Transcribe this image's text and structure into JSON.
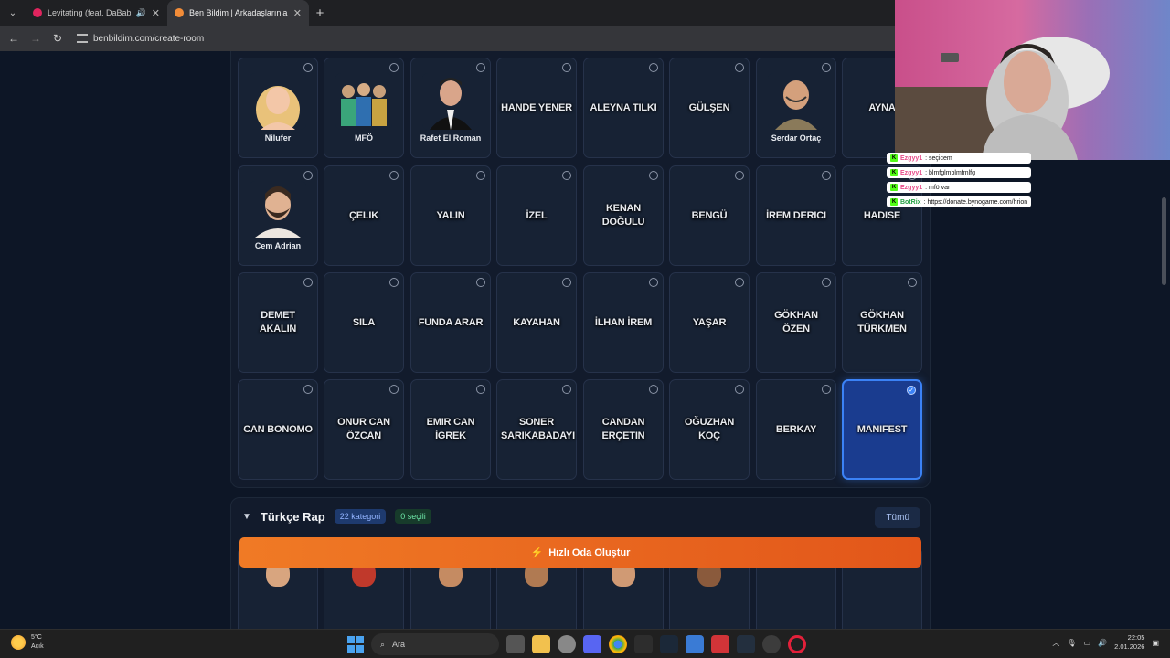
{
  "browser": {
    "tabs": [
      {
        "title": "Levitating (feat. DaBaby) - Y",
        "active": false,
        "favicon_color": "#e0245e"
      },
      {
        "title": "Ben Bildim | Arkadaşlarınla Onl",
        "active": true,
        "favicon_color": "#f28c38"
      }
    ],
    "url": "benbildim.com/create-room"
  },
  "grid": {
    "cards": [
      {
        "label": "Nilufer",
        "type": "image",
        "avatar": "woman-blonde"
      },
      {
        "label": "MFÖ",
        "type": "image",
        "avatar": "trio"
      },
      {
        "label": "Rafet El Roman",
        "type": "image",
        "avatar": "man-tuxedo"
      },
      {
        "label": "HANDE YENER",
        "type": "text"
      },
      {
        "label": "ALEYNA TILKI",
        "type": "text"
      },
      {
        "label": "GÜLŞEN",
        "type": "text"
      },
      {
        "label": "Serdar Ortaç",
        "type": "image",
        "avatar": "man-bald"
      },
      {
        "label": "AYNA",
        "type": "text"
      },
      {
        "label": "Cem Adrian",
        "type": "image",
        "avatar": "man-beard"
      },
      {
        "label": "ÇELIK",
        "type": "text"
      },
      {
        "label": "YALIN",
        "type": "text"
      },
      {
        "label": "İZEL",
        "type": "text"
      },
      {
        "label": "KENAN DOĞULU",
        "type": "text"
      },
      {
        "label": "BENGÜ",
        "type": "text"
      },
      {
        "label": "İREM DERICI",
        "type": "text"
      },
      {
        "label": "HADISE",
        "type": "text"
      },
      {
        "label": "DEMET AKALIN",
        "type": "text"
      },
      {
        "label": "SILA",
        "type": "text"
      },
      {
        "label": "FUNDA ARAR",
        "type": "text"
      },
      {
        "label": "KAYAHAN",
        "type": "text"
      },
      {
        "label": "İLHAN İREM",
        "type": "text"
      },
      {
        "label": "YAŞAR",
        "type": "text"
      },
      {
        "label": "GÖKHAN ÖZEN",
        "type": "text"
      },
      {
        "label": "GÖKHAN TÜRKMEN",
        "type": "text"
      },
      {
        "label": "CAN BONOMO",
        "type": "text"
      },
      {
        "label": "ONUR CAN ÖZCAN",
        "type": "text"
      },
      {
        "label": "EMIR CAN İGREK",
        "type": "text"
      },
      {
        "label": "SONER SARIKABADAYI",
        "type": "text"
      },
      {
        "label": "CANDAN ERÇETIN",
        "type": "text"
      },
      {
        "label": "OĞUZHAN KOÇ",
        "type": "text"
      },
      {
        "label": "BERKAY",
        "type": "text"
      },
      {
        "label": "MANIFEST",
        "type": "text",
        "selected": true
      }
    ]
  },
  "section": {
    "title": "Türkçe Rap",
    "categories_badge": "22 kategori",
    "selected_badge": "0 seçili",
    "all_button": "Tümü"
  },
  "create_button": "Hızlı Oda Oluştur",
  "chat": [
    {
      "user": "Ezgyy1",
      "message": ": seçicem",
      "user_color": "pink"
    },
    {
      "user": "Ezgyy1",
      "message": ": blmfglmblmfmlfg",
      "user_color": "pink"
    },
    {
      "user": "Ezgyy1",
      "message": ": mfö var",
      "user_color": "pink"
    },
    {
      "user": "BotRix",
      "message": ": https://donate.bynogame.com/hrion",
      "user_color": "green"
    }
  ],
  "taskbar": {
    "weather_temp": "5°C",
    "weather_desc": "Açık",
    "search_placeholder": "Ara",
    "time": "22:05",
    "date": "2.01.2026"
  },
  "colors": {
    "accent_orange": "#f07a25",
    "selected_blue": "#3b82f6",
    "card_bg": "#172234",
    "page_bg": "#0d1626"
  }
}
